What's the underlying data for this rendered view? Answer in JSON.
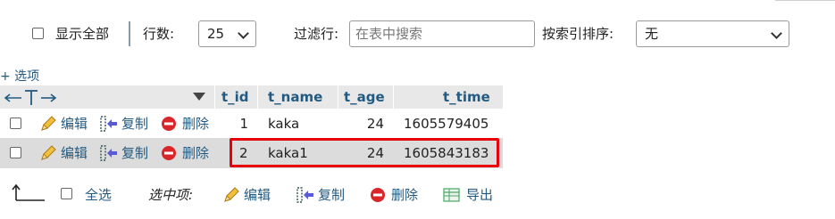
{
  "toolbar": {
    "show_all_label": "显示全部",
    "rows_label": "行数:",
    "rows_value": "25",
    "filter_label": "过滤行:",
    "filter_placeholder": "在表中搜索",
    "sort_label": "按索引排序:",
    "sort_value": "无"
  },
  "table": {
    "options_label": "+ 选项",
    "columns": [
      "t_id",
      "t_name",
      "t_age",
      "t_time"
    ],
    "actions": {
      "edit": "编辑",
      "copy": "复制",
      "delete": "删除"
    },
    "rows": [
      {
        "t_id": "1",
        "t_name": "kaka",
        "t_age": "24",
        "t_time": "1605579405"
      },
      {
        "t_id": "2",
        "t_name": "kaka1",
        "t_age": "24",
        "t_time": "1605843183"
      }
    ]
  },
  "bulk": {
    "select_all_label": "全选",
    "selected_label": "选中项:",
    "edit_label": "编辑",
    "copy_label": "复制",
    "delete_label": "删除",
    "export_label": "导出"
  },
  "colors": {
    "link": "#235a81",
    "header_bg": "#e8e8e8",
    "row_alt_bg": "#dcdcdc",
    "highlight_border": "#e8000b",
    "delete_icon": "#d9262b"
  },
  "icons": {
    "edit": "pencil-icon",
    "copy": "copy-icon",
    "delete": "delete-icon",
    "export": "export-icon",
    "select_arrow": "return-arrow-icon",
    "column_toggle": "column-arrows-icon",
    "sort": "sort-down-icon"
  }
}
